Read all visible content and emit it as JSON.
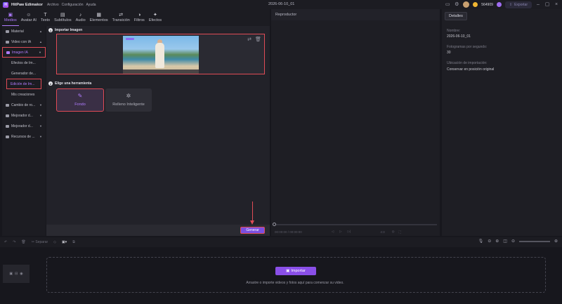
{
  "titlebar": {
    "logo_glyph": "H",
    "app_name": "HitPaw Edimakor",
    "menu": [
      "Archivo",
      "Configuración",
      "Ayuda"
    ],
    "project_name": "2026-06-10_01",
    "credits": "564909",
    "export_label": "Exportar"
  },
  "toolbar": [
    {
      "label": "Medios",
      "icon": "media-icon",
      "glyph": "▣",
      "active": true
    },
    {
      "label": "Avatar AI",
      "icon": "avatar-icon",
      "glyph": "☺"
    },
    {
      "label": "Texto",
      "icon": "text-icon",
      "glyph": "T"
    },
    {
      "label": "Subtítulos",
      "icon": "subtitles-icon",
      "glyph": "▤"
    },
    {
      "label": "Audio",
      "icon": "audio-icon",
      "glyph": "♪"
    },
    {
      "label": "Elementos",
      "icon": "elements-icon",
      "glyph": "▦"
    },
    {
      "label": "Transición",
      "icon": "transition-icon",
      "glyph": "⇄"
    },
    {
      "label": "Filtros",
      "icon": "filters-icon",
      "glyph": "◑"
    },
    {
      "label": "Efectos",
      "icon": "effects-icon",
      "glyph": "✦"
    }
  ],
  "sidebar": [
    {
      "label": "Material",
      "type": "folder"
    },
    {
      "label": "Video con IA",
      "type": "folder"
    },
    {
      "label": "Imagen IA",
      "type": "folder",
      "purple": true,
      "highlight": true
    },
    {
      "label": "Efectos de Im...",
      "type": "sub"
    },
    {
      "label": "Generador de...",
      "type": "sub"
    },
    {
      "label": "Edición de Im...",
      "type": "sub",
      "purple": true,
      "highlight": true
    },
    {
      "label": "Mis creaciones",
      "type": "sub"
    },
    {
      "label": "Cambio de ro...",
      "type": "folder"
    },
    {
      "label": "Mejorador d...",
      "type": "folder"
    },
    {
      "label": "Mejorador d...",
      "type": "folder"
    },
    {
      "label": "Recursos de ...",
      "type": "folder"
    }
  ],
  "content": {
    "step1_num": "1",
    "step1_title": "Importar Imagen",
    "step2_num": "2",
    "step2_title": "Elige una herramienta",
    "tool_background": "Fondo",
    "tool_fill": "Relleno Inteligente",
    "generate_label": "Generar"
  },
  "player": {
    "title": "Reproductor",
    "time": "00:00:00 / 00:00:00",
    "speed": "4:3"
  },
  "details": {
    "tab": "Detalles",
    "name_label": "Nombre:",
    "name_value": "2026-06-10_01",
    "fps_label": "Fotogramas por segundo:",
    "fps_value": "30",
    "import_label": "Ubicación de importación:",
    "import_value": "Conservar en posición original"
  },
  "timeline": {
    "separate_label": "Separar",
    "import_label": "Importar",
    "hint": "Arrastre o importe videos y fotos aquí para comenzar su video."
  }
}
